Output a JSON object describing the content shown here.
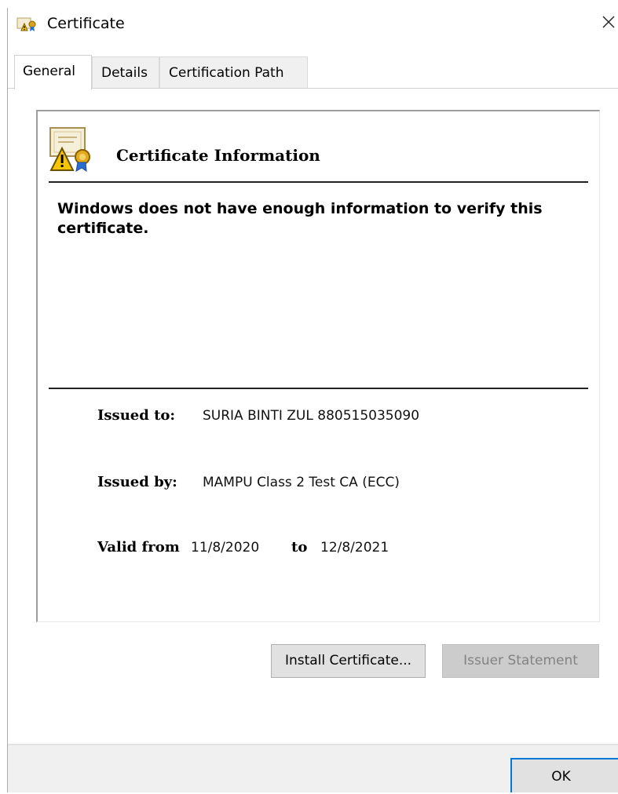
{
  "window": {
    "title": "Certificate",
    "icon": "certificate-icon",
    "close_icon": "close-icon"
  },
  "tabs": [
    {
      "label": "General",
      "active": true
    },
    {
      "label": "Details",
      "active": false
    },
    {
      "label": "Certification Path",
      "active": false
    }
  ],
  "general": {
    "heading": "Certificate Information",
    "heading_icon": "certificate-warning-icon",
    "message": "Windows does not have enough information to verify this certificate.",
    "issued_to_label": "Issued to:",
    "issued_to": "SURIA BINTI ZUL 880515035090",
    "issued_by_label": "Issued by:",
    "issued_by": "MAMPU Class 2 Test CA (ECC)",
    "valid_from_label": "Valid from",
    "valid_from": "11/8/2020",
    "valid_to_label": "to",
    "valid_to": "12/8/2021"
  },
  "buttons": {
    "install": "Install Certificate...",
    "issuer_statement": "Issuer Statement",
    "issuer_statement_enabled": false,
    "ok": "OK"
  },
  "colors": {
    "accent": "#0078d7",
    "disabled_text": "#838383"
  }
}
